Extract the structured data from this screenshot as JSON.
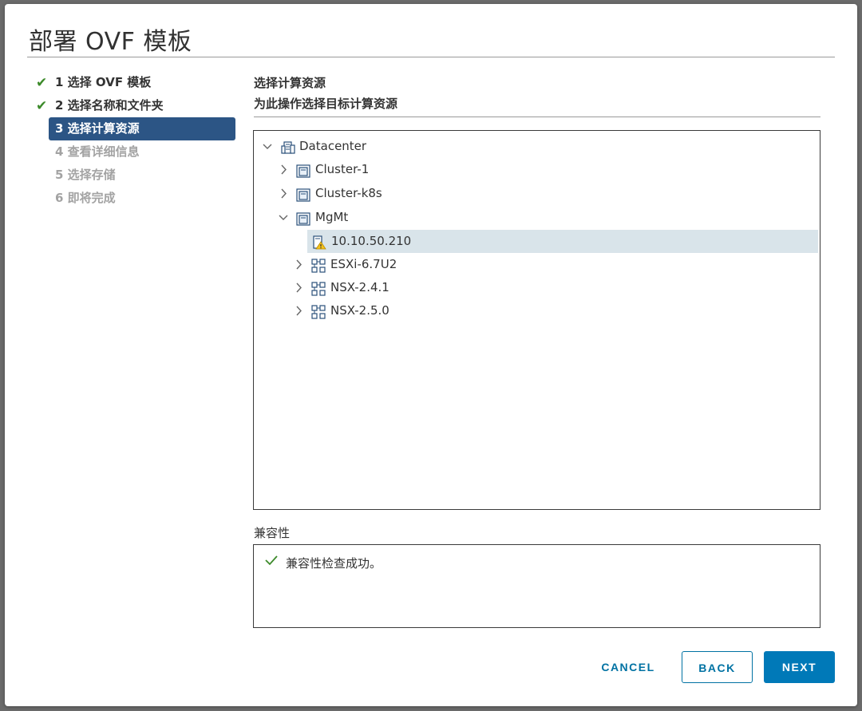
{
  "dialog": {
    "title": "部署 OVF 模板"
  },
  "steps": [
    {
      "label": "1 选择 OVF 模板",
      "state": "done"
    },
    {
      "label": "2 选择名称和文件夹",
      "state": "done"
    },
    {
      "label": "3 选择计算资源",
      "state": "active"
    },
    {
      "label": "4 查看详细信息",
      "state": "pending"
    },
    {
      "label": "5 选择存储",
      "state": "pending"
    },
    {
      "label": "6 即将完成",
      "state": "pending"
    }
  ],
  "section": {
    "title": "选择计算资源",
    "subtitle": "为此操作选择目标计算资源"
  },
  "tree": {
    "nodes": [
      {
        "label": "Datacenter",
        "icon": "datacenter-icon",
        "expanded": true
      },
      {
        "label": "Cluster-1",
        "icon": "cluster-icon",
        "expanded": false
      },
      {
        "label": "Cluster-k8s",
        "icon": "cluster-icon",
        "expanded": false
      },
      {
        "label": "MgMt",
        "icon": "cluster-icon",
        "expanded": true
      },
      {
        "label": "10.10.50.210",
        "icon": "host-warning-icon",
        "selected": true
      },
      {
        "label": "ESXi-6.7U2",
        "icon": "vapp-icon",
        "expanded": false
      },
      {
        "label": "NSX-2.4.1",
        "icon": "vapp-icon",
        "expanded": false
      },
      {
        "label": "NSX-2.5.0",
        "icon": "vapp-icon",
        "expanded": false
      }
    ]
  },
  "compatibility": {
    "title": "兼容性",
    "message": "兼容性检查成功。"
  },
  "buttons": {
    "cancel": "CANCEL",
    "back": "BACK",
    "next": "NEXT"
  },
  "colors": {
    "accent": "#0079b8",
    "active_step": "#2c5585",
    "success": "#3c8a2a",
    "selected_row": "#d9e4ea"
  }
}
